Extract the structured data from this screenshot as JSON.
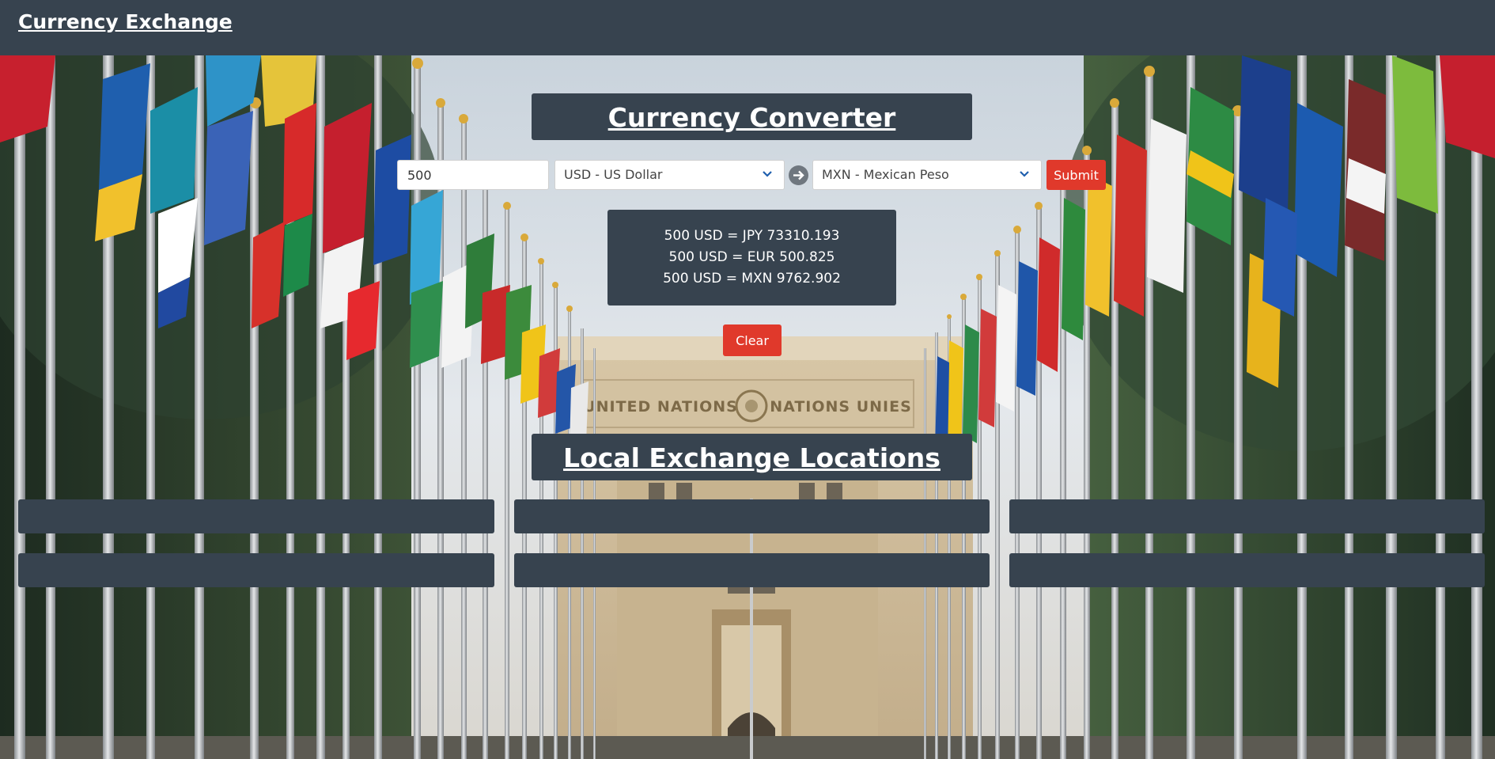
{
  "navbar": {
    "brand": "Currency Exchange"
  },
  "converter": {
    "title": "Currency Converter",
    "amount": "500",
    "from_currency": "USD - US Dollar",
    "to_currency": "MXN - Mexican Peso",
    "submit_label": "Submit",
    "results": [
      "500 USD = JPY 73310.193",
      "500 USD = EUR 500.825",
      "500 USD = MXN 9762.902"
    ],
    "clear_label": "Clear"
  },
  "locations": {
    "title": "Local Exchange Locations",
    "cards": [
      "",
      "",
      "",
      "",
      "",
      ""
    ]
  },
  "background": {
    "sign_left": "UNITED NATIONS",
    "sign_right": "NATIONS UNIES"
  },
  "colors": {
    "panel": "#37434f",
    "accent": "#e0392b",
    "text": "#ffffff"
  }
}
